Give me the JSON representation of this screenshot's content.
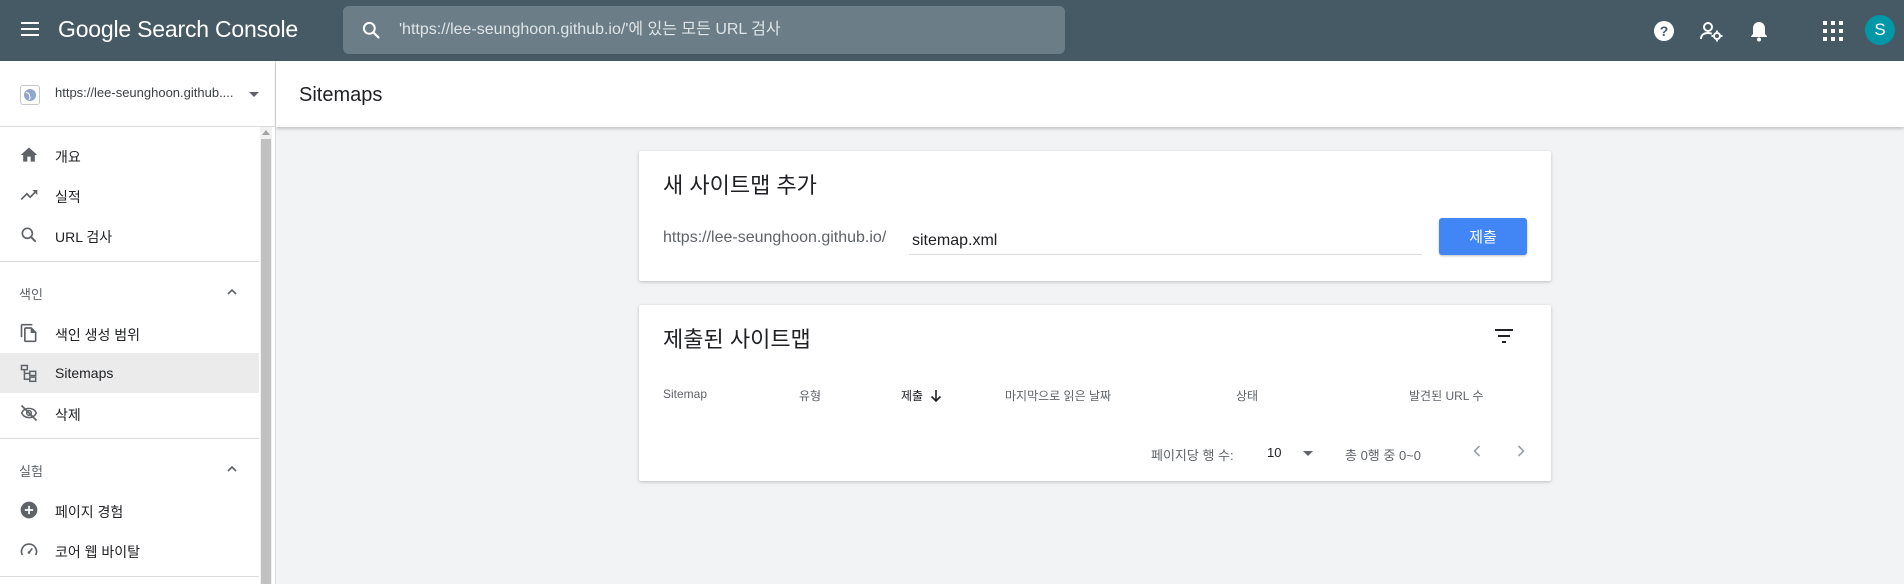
{
  "app": {
    "title": "Google Search Console"
  },
  "search": {
    "placeholder": "'https://lee-seunghoon.github.io/'에 있는 모든 URL 검사"
  },
  "user": {
    "initial": "S"
  },
  "property": {
    "url": "https://lee-seunghoon.github...."
  },
  "sidebar": {
    "items": [
      {
        "label": "개요",
        "icon": "home-icon"
      },
      {
        "label": "실적",
        "icon": "trending-up-icon"
      },
      {
        "label": "URL 검사",
        "icon": "search-icon"
      }
    ],
    "sections": [
      {
        "title": "색인",
        "items": [
          {
            "label": "색인 생성 범위",
            "icon": "copy-pages-icon"
          },
          {
            "label": "Sitemaps",
            "icon": "sitemap-icon",
            "active": true
          },
          {
            "label": "삭제",
            "icon": "visibility-off-icon"
          }
        ]
      },
      {
        "title": "실험",
        "items": [
          {
            "label": "페이지 경험",
            "icon": "add-circle-icon"
          },
          {
            "label": "코어 웹 바이탈",
            "icon": "speed-gauge-icon"
          }
        ]
      }
    ]
  },
  "page": {
    "title": "Sitemaps"
  },
  "add_sitemap": {
    "heading": "새 사이트맵 추가",
    "prefix": "https://lee-seunghoon.github.io/",
    "value": "sitemap.xml",
    "submit_label": "제출"
  },
  "submitted": {
    "heading": "제출된 사이트맵",
    "columns": [
      "Sitemap",
      "유형",
      "제출",
      "마지막으로 읽은 날짜",
      "상태",
      "발견된 URL 수"
    ],
    "sorted_column": "제출",
    "rows": [],
    "pagination": {
      "rows_per_page_label": "페이지당 행 수:",
      "rows_per_page": "10",
      "range": "총 0행 중 0~0"
    }
  },
  "colors": {
    "topbar": "#455a64",
    "accent": "#4285f4",
    "avatar": "#0097a7"
  }
}
